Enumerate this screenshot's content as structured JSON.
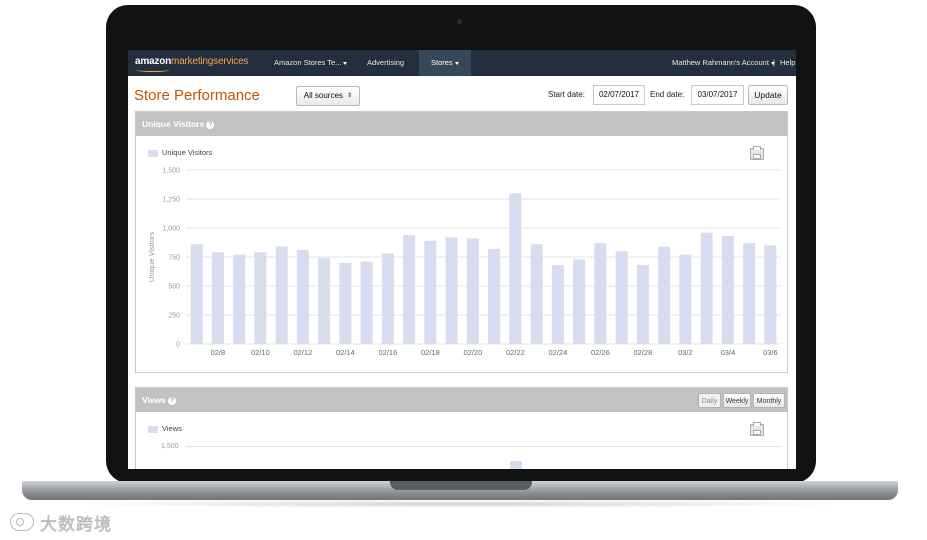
{
  "nav": {
    "brand_main": "amazon",
    "brand_accent": "marketingservices",
    "items": [
      {
        "label": "Amazon Stores Te...",
        "caret": true
      },
      {
        "label": "Advertising",
        "caret": false
      },
      {
        "label": "Stores",
        "caret": true
      }
    ],
    "account_label": "Matthew Rahmann's Account",
    "separator": "|",
    "help_label": "Help"
  },
  "page": {
    "title": "Store Performance",
    "sources_label": "All sources",
    "start_label": "Start date:",
    "start_value": "02/07/2017",
    "end_label": "End date:",
    "end_value": "03/07/2017",
    "update_label": "Update"
  },
  "visitors_panel": {
    "title": "Unique Visitors",
    "help": "?",
    "legend": "Unique Visitors"
  },
  "views_panel": {
    "title": "Views",
    "help": "?",
    "legend": "Views",
    "first_tick": "1,500",
    "segments": [
      {
        "label": "Daily",
        "active": true
      },
      {
        "label": "Weekly",
        "active": false
      },
      {
        "label": "Monthly",
        "active": false
      }
    ]
  },
  "watermark": {
    "text": "大数跨境"
  },
  "colors": {
    "nav_bg": "#232f3e",
    "accent": "#c45500",
    "bar": "#d7dcef",
    "panel_head": "#c2c2c2"
  },
  "chart_data": {
    "type": "bar",
    "categories": [
      "02/7",
      "02/8",
      "02/9",
      "02/10",
      "02/11",
      "02/12",
      "02/13",
      "02/14",
      "02/15",
      "02/16",
      "02/17",
      "02/18",
      "02/19",
      "02/20",
      "02/21",
      "02/22",
      "02/23",
      "02/24",
      "02/25",
      "02/26",
      "02/27",
      "02/28",
      "03/1",
      "03/2",
      "03/3",
      "03/4",
      "03/5",
      "03/6"
    ],
    "tick_labels": [
      "02/8",
      "02/10",
      "02/12",
      "02/14",
      "02/16",
      "02/18",
      "02/20",
      "02/22",
      "02/24",
      "02/26",
      "02/28",
      "03/2",
      "03/4",
      "03/6"
    ],
    "series": [
      {
        "name": "Unique Visitors",
        "values": [
          860,
          790,
          770,
          790,
          840,
          810,
          740,
          700,
          710,
          780,
          940,
          890,
          920,
          910,
          820,
          1300,
          860,
          680,
          730,
          870,
          800,
          680,
          840,
          770,
          960,
          930,
          870,
          850
        ]
      }
    ],
    "ylabel": "Unique Visitors",
    "yticks": [
      0,
      250,
      500,
      750,
      1000,
      1250,
      1500
    ],
    "ytick_labels": [
      "0",
      "250",
      "500",
      "750",
      "1,000",
      "1,250",
      "1,500"
    ],
    "ylim": [
      0,
      1500
    ],
    "grid": true,
    "legend": "top-left"
  }
}
